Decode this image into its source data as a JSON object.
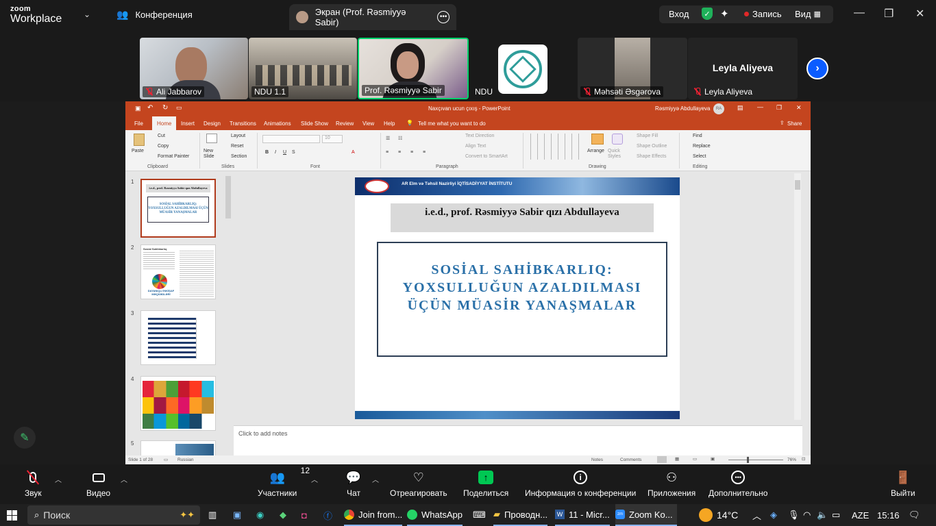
{
  "topbar": {
    "logo_line1": "zoom",
    "logo_line2": "Workplace",
    "conference": "Конференция",
    "screen_tab": "Экран (Prof. Rəsmiyyə Sabir)",
    "login": "Вход",
    "record": "Запись",
    "view": "Вид"
  },
  "participants": [
    {
      "name": "Ali Jabbarov",
      "muted": true
    },
    {
      "name": "NDU 1.1",
      "muted": false
    },
    {
      "name": "Prof. Rəsmiyyə Sabir",
      "muted": false
    },
    {
      "name": "NDU",
      "muted": false
    },
    {
      "name": "Məhsəti Əsgərova",
      "muted": true
    },
    {
      "name": "Leyla Aliyeva",
      "muted": true,
      "big_name": "Leyla Aliyeva"
    }
  ],
  "ppt": {
    "doc_title": "Naxçıvan ucun çıxış  -  PowerPoint",
    "user": "Rəsmiyyə Abdullayeva",
    "user_initials": "RA",
    "tabs": [
      "File",
      "Home",
      "Insert",
      "Design",
      "Transitions",
      "Animations",
      "Slide Show",
      "Review",
      "View",
      "Help"
    ],
    "tell_me": "Tell me what you want to do",
    "share": "Share",
    "ribbon": {
      "paste": "Paste",
      "cut": "Cut",
      "copy": "Copy",
      "format_painter": "Format Painter",
      "clipboard": "Clipboard",
      "new_slide": "New Slide",
      "layout": "Layout",
      "reset": "Reset",
      "section": "Section",
      "slides": "Slides",
      "font_group": "Font",
      "font_size": "10",
      "text_direction": "Text Direction",
      "align_text": "Align Text",
      "smartart": "Convert to SmartArt",
      "paragraph": "Paragraph",
      "arrange": "Arrange",
      "quick_styles": "Quick Styles",
      "shape_fill": "Shape Fill",
      "shape_outline": "Shape Outline",
      "shape_effects": "Shape Effects",
      "drawing": "Drawing",
      "find": "Find",
      "replace": "Replace",
      "select": "Select",
      "editing": "Editing"
    },
    "slide_numbers": [
      "1",
      "2",
      "3",
      "4",
      "5"
    ],
    "thumb1": {
      "author": "i.e.d., prof. Rəsmiyyə Sabir qızı Abdullayeva",
      "title": "SOSİAL SAHİBKARLIQ: YOXSULLUĞUN AZALDILMASI ÜÇÜN MÜASİR YANAŞMALAR"
    },
    "thumb2": {
      "heading": "Sosial Sahibkarlıq",
      "caption": "DAYANIQLI İNKİŞAF MƏQSƏDLƏRİ"
    },
    "slide": {
      "header": "AR Elm və Təhsil Nazirliyi İQTİSADİYYAT İNSTİTUTU",
      "author": "i.e.d., prof. Rəsmiyyə Sabir qızı Abdullayeva",
      "title_line1": "SOSİAL SAHİBKARLIQ:",
      "title_line2": "YOXSULLUĞUN AZALDILMASI",
      "title_line3": "ÜÇÜN MÜASİR YANAŞMALAR"
    },
    "notes_placeholder": "Click to add notes",
    "status": {
      "slide": "Slide 1 of 28",
      "language": "Russian",
      "notes": "Notes",
      "comments": "Comments",
      "zoom": "76%"
    }
  },
  "zoombar": {
    "mute": "Звук",
    "video": "Видео",
    "participants": "Участники",
    "participants_count": "12",
    "chat": "Чат",
    "react": "Отреагировать",
    "share": "Поделиться",
    "info": "Информация о конференции",
    "apps": "Приложения",
    "more": "Дополнительно",
    "leave": "Выйти"
  },
  "taskbar": {
    "search": "Поиск",
    "chrome": "Join from...",
    "whatsapp": "WhatsApp",
    "explorer": "Проводн...",
    "word": "11 - Micr...",
    "zoom": "Zoom Ko...",
    "temp": "14°C",
    "lang": "AZE",
    "time": "15:16"
  },
  "colors": {
    "ppt_red": "#c4451f",
    "slide_title": "#2a70a8",
    "zoom_green": "#00d26a",
    "record_red": "#e02828"
  }
}
